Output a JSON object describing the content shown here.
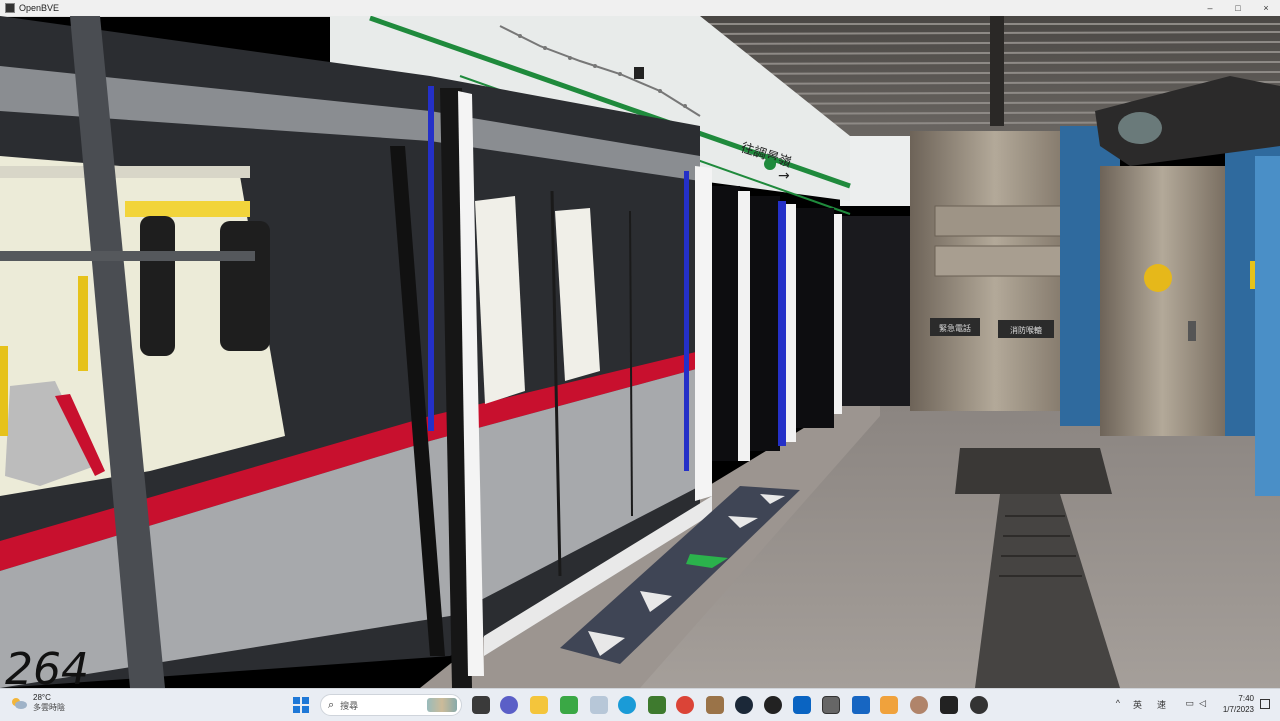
{
  "window": {
    "title": "OpenBVE",
    "controls": [
      "–",
      "□",
      "×"
    ]
  },
  "scene": {
    "car_number": "264",
    "sign_text": "往調景嶺",
    "sign_arrow": "→",
    "platform_sign_1": "緊急電話",
    "platform_sign_2": "消防喉轆"
  },
  "taskbar": {
    "weather": {
      "temp": "28°C",
      "desc": "多雲時陰"
    },
    "search": {
      "placeholder": "搜尋"
    },
    "apps": [
      "file-explorer",
      "chat",
      "folder",
      "store",
      "photos",
      "edge",
      "minecraft",
      "chrome",
      "package",
      "steam",
      "obs",
      "outlook",
      "openbve",
      "paint",
      "office",
      "avatar",
      "terminal",
      "game"
    ],
    "tray": {
      "chevron": "^",
      "lang": "英",
      "ime": "速"
    },
    "clock": {
      "time": "7:40",
      "date": "1/7/2023"
    }
  },
  "colors": {
    "train_stripe": "#c8102e",
    "platform_green": "#1f8a3c",
    "taskbar": "#e9edf3"
  }
}
